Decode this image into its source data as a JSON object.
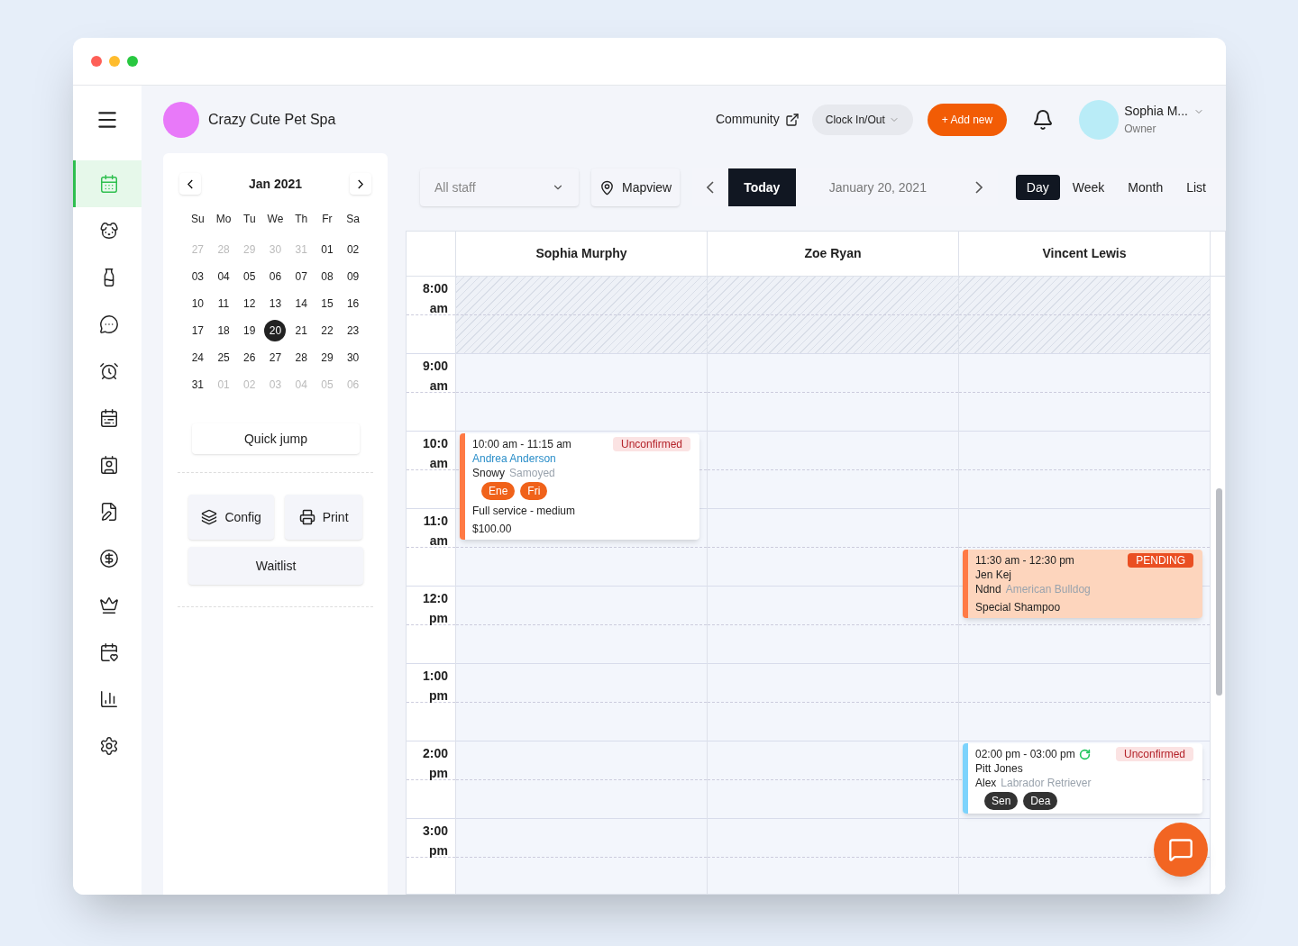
{
  "sidebar": {
    "items": [
      {
        "selected": true
      },
      {
        "selected": false
      },
      {
        "selected": false
      },
      {
        "selected": false
      },
      {
        "selected": false
      },
      {
        "selected": false
      },
      {
        "selected": false
      },
      {
        "selected": false
      },
      {
        "selected": false
      },
      {
        "selected": false
      },
      {
        "selected": false
      },
      {
        "selected": false
      },
      {
        "selected": false
      }
    ]
  },
  "header": {
    "business_name": "Crazy Cute Pet Spa",
    "community": "Community",
    "clock": "Clock In/Out",
    "add_new": "+ Add new",
    "user_name": "Sophia M...",
    "user_role": "Owner"
  },
  "mini_calendar": {
    "month": "Jan 2021",
    "weekdays": [
      "Su",
      "Mo",
      "Tu",
      "We",
      "Th",
      "Fr",
      "Sa"
    ],
    "days": [
      {
        "label": "27",
        "muted": true,
        "selected": false
      },
      {
        "label": "28",
        "muted": true,
        "selected": false
      },
      {
        "label": "29",
        "muted": true,
        "selected": false
      },
      {
        "label": "30",
        "muted": true,
        "selected": false
      },
      {
        "label": "31",
        "muted": true,
        "selected": false
      },
      {
        "label": "01",
        "muted": false,
        "selected": false
      },
      {
        "label": "02",
        "muted": false,
        "selected": false
      },
      {
        "label": "03",
        "muted": false,
        "selected": false
      },
      {
        "label": "04",
        "muted": false,
        "selected": false
      },
      {
        "label": "05",
        "muted": false,
        "selected": false
      },
      {
        "label": "06",
        "muted": false,
        "selected": false
      },
      {
        "label": "07",
        "muted": false,
        "selected": false
      },
      {
        "label": "08",
        "muted": false,
        "selected": false
      },
      {
        "label": "09",
        "muted": false,
        "selected": false
      },
      {
        "label": "10",
        "muted": false,
        "selected": false
      },
      {
        "label": "11",
        "muted": false,
        "selected": false
      },
      {
        "label": "12",
        "muted": false,
        "selected": false
      },
      {
        "label": "13",
        "muted": false,
        "selected": false
      },
      {
        "label": "14",
        "muted": false,
        "selected": false
      },
      {
        "label": "15",
        "muted": false,
        "selected": false
      },
      {
        "label": "16",
        "muted": false,
        "selected": false
      },
      {
        "label": "17",
        "muted": false,
        "selected": false
      },
      {
        "label": "18",
        "muted": false,
        "selected": false
      },
      {
        "label": "19",
        "muted": false,
        "selected": false
      },
      {
        "label": "20",
        "muted": false,
        "selected": true
      },
      {
        "label": "21",
        "muted": false,
        "selected": false
      },
      {
        "label": "22",
        "muted": false,
        "selected": false
      },
      {
        "label": "23",
        "muted": false,
        "selected": false
      },
      {
        "label": "24",
        "muted": false,
        "selected": false
      },
      {
        "label": "25",
        "muted": false,
        "selected": false
      },
      {
        "label": "26",
        "muted": false,
        "selected": false
      },
      {
        "label": "27",
        "muted": false,
        "selected": false
      },
      {
        "label": "28",
        "muted": false,
        "selected": false
      },
      {
        "label": "29",
        "muted": false,
        "selected": false
      },
      {
        "label": "30",
        "muted": false,
        "selected": false
      },
      {
        "label": "31",
        "muted": false,
        "selected": false
      },
      {
        "label": "01",
        "muted": true,
        "selected": false
      },
      {
        "label": "02",
        "muted": true,
        "selected": false
      },
      {
        "label": "03",
        "muted": true,
        "selected": false
      },
      {
        "label": "04",
        "muted": true,
        "selected": false
      },
      {
        "label": "05",
        "muted": true,
        "selected": false
      },
      {
        "label": "06",
        "muted": true,
        "selected": false
      }
    ],
    "quick_jump": "Quick jump"
  },
  "actions": {
    "config": "Config",
    "print": "Print",
    "waitlist": "Waitlist"
  },
  "toolbar": {
    "staff_select": "All staff",
    "mapview": "Mapview",
    "today": "Today",
    "date": "January 20, 2021",
    "views": [
      {
        "label": "Day",
        "selected": true
      },
      {
        "label": "Week",
        "selected": false
      },
      {
        "label": "Month",
        "selected": false
      },
      {
        "label": "List",
        "selected": false
      }
    ]
  },
  "schedule": {
    "columns": [
      {
        "staff": "Sophia Murphy",
        "events": [
          {
            "time": "10:00 am - 11:15 am",
            "recurring": false,
            "status": "Unconfirmed",
            "kind": "unconfirmed",
            "color": "#ff7a45",
            "client": "Andrea Anderson",
            "client_link": true,
            "pet": "Snowy",
            "breed": "Samoyed",
            "tags": [
              {
                "label": "Ene",
                "color": "#f0621a"
              },
              {
                "label": "Fri",
                "color": "#f0621a"
              }
            ],
            "services": [
              "Full service - medium",
              "$100.00"
            ]
          }
        ]
      },
      {
        "staff": "Zoe Ryan"
      },
      {
        "staff": "Vincent Lewis",
        "events": [
          {
            "time": "11:30 am - 12:30 pm",
            "recurring": false,
            "status": "PENDING",
            "kind": "pending",
            "color": "#ff7a45",
            "client": "Jen Kej",
            "client_link": false,
            "pet": "Ndnd",
            "breed": "American Bulldog",
            "services": [
              "Special Shampoo"
            ]
          },
          {
            "time": "02:00 pm - 03:00 pm",
            "recurring": true,
            "status": "Unconfirmed",
            "kind": "unconfirmed",
            "color": "#7dd3fc",
            "client": "Pitt Jones",
            "client_link": false,
            "pet": "Alex",
            "breed": "Labrador Retriever",
            "tags": [
              {
                "label": "Sen",
                "color": "#333333"
              },
              {
                "label": "Dea",
                "color": "#333333"
              }
            ]
          }
        ]
      }
    ],
    "hours": [
      {
        "time": "8:00",
        "period": "am",
        "unavailable": true
      },
      {
        "time": "9:00",
        "period": "am",
        "unavailable": false
      },
      {
        "time": "10:0",
        "period": "am",
        "unavailable": false
      },
      {
        "time": "11:0",
        "period": "am",
        "unavailable": false
      },
      {
        "time": "12:0",
        "period": "pm",
        "unavailable": false
      },
      {
        "time": "1:00",
        "period": "pm",
        "unavailable": false
      },
      {
        "time": "2:00",
        "period": "pm",
        "unavailable": false
      },
      {
        "time": "3:00",
        "period": "pm",
        "unavailable": false
      }
    ]
  }
}
